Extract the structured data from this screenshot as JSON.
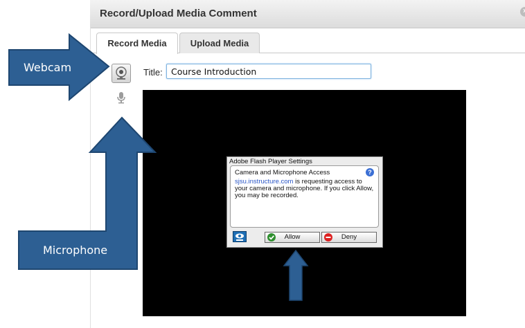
{
  "dialog": {
    "title": "Record/Upload Media Comment"
  },
  "tabs": [
    {
      "label": "Record Media",
      "active": true
    },
    {
      "label": "Upload Media",
      "active": false
    }
  ],
  "form": {
    "title_label": "Title:",
    "title_value": "Course Introduction"
  },
  "flash_dialog": {
    "window_title": "Adobe Flash Player Settings",
    "heading": "Camera and Microphone Access",
    "link": "sjsu.instructure.com",
    "message": " is requesting access to your camera and microphone. If you click Allow, you may be recorded.",
    "allow_label": "Allow",
    "deny_label": "Deny"
  },
  "callouts": {
    "webcam": "Webcam",
    "microphone": "Microphone"
  },
  "colors": {
    "callout_fill": "#2d5f93",
    "callout_border": "#1e4670",
    "input_border": "#7fb3df"
  },
  "icons": [
    "webcam-icon",
    "microphone-icon",
    "close-icon",
    "help-icon",
    "monitor-icon",
    "allow-check-icon",
    "deny-icon"
  ]
}
